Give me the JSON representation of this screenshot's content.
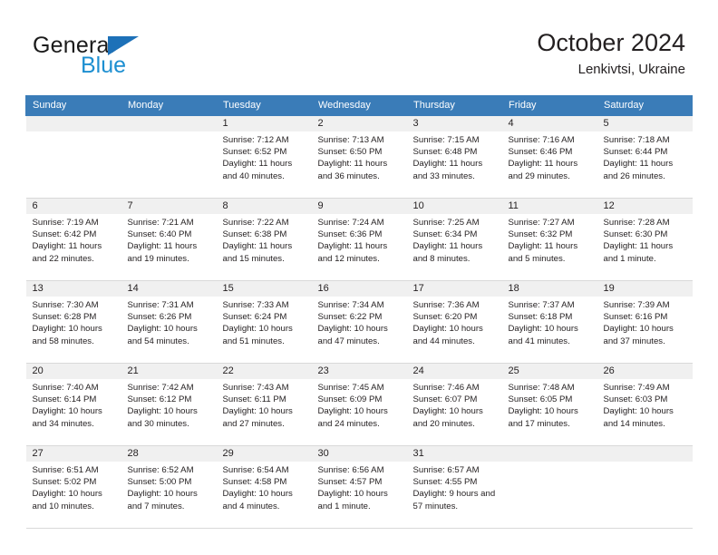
{
  "brand": {
    "name_top": "General",
    "name_bottom": "Blue",
    "triangle_color": "#1d71b8",
    "blue_color": "#1d8fd1"
  },
  "header": {
    "title": "October 2024",
    "subtitle": "Lenkivtsi, Ukraine"
  },
  "theme": {
    "header_row_bg": "#3a7cb8",
    "header_row_text": "#ffffff",
    "daynum_band_bg": "#f0f0f0",
    "grid_line": "#d9d9d9",
    "text": "#231f20"
  },
  "weekdays": [
    "Sunday",
    "Monday",
    "Tuesday",
    "Wednesday",
    "Thursday",
    "Friday",
    "Saturday"
  ],
  "labels": {
    "sunrise_prefix": "Sunrise:",
    "sunset_prefix": "Sunset:",
    "daylight_prefix": "Daylight:"
  },
  "weeks": [
    [
      {
        "day": "",
        "sunrise": "",
        "sunset": "",
        "daylight": ""
      },
      {
        "day": "",
        "sunrise": "",
        "sunset": "",
        "daylight": ""
      },
      {
        "day": "1",
        "sunrise": "Sunrise: 7:12 AM",
        "sunset": "Sunset: 6:52 PM",
        "daylight": "Daylight: 11 hours and 40 minutes."
      },
      {
        "day": "2",
        "sunrise": "Sunrise: 7:13 AM",
        "sunset": "Sunset: 6:50 PM",
        "daylight": "Daylight: 11 hours and 36 minutes."
      },
      {
        "day": "3",
        "sunrise": "Sunrise: 7:15 AM",
        "sunset": "Sunset: 6:48 PM",
        "daylight": "Daylight: 11 hours and 33 minutes."
      },
      {
        "day": "4",
        "sunrise": "Sunrise: 7:16 AM",
        "sunset": "Sunset: 6:46 PM",
        "daylight": "Daylight: 11 hours and 29 minutes."
      },
      {
        "day": "5",
        "sunrise": "Sunrise: 7:18 AM",
        "sunset": "Sunset: 6:44 PM",
        "daylight": "Daylight: 11 hours and 26 minutes."
      }
    ],
    [
      {
        "day": "6",
        "sunrise": "Sunrise: 7:19 AM",
        "sunset": "Sunset: 6:42 PM",
        "daylight": "Daylight: 11 hours and 22 minutes."
      },
      {
        "day": "7",
        "sunrise": "Sunrise: 7:21 AM",
        "sunset": "Sunset: 6:40 PM",
        "daylight": "Daylight: 11 hours and 19 minutes."
      },
      {
        "day": "8",
        "sunrise": "Sunrise: 7:22 AM",
        "sunset": "Sunset: 6:38 PM",
        "daylight": "Daylight: 11 hours and 15 minutes."
      },
      {
        "day": "9",
        "sunrise": "Sunrise: 7:24 AM",
        "sunset": "Sunset: 6:36 PM",
        "daylight": "Daylight: 11 hours and 12 minutes."
      },
      {
        "day": "10",
        "sunrise": "Sunrise: 7:25 AM",
        "sunset": "Sunset: 6:34 PM",
        "daylight": "Daylight: 11 hours and 8 minutes."
      },
      {
        "day": "11",
        "sunrise": "Sunrise: 7:27 AM",
        "sunset": "Sunset: 6:32 PM",
        "daylight": "Daylight: 11 hours and 5 minutes."
      },
      {
        "day": "12",
        "sunrise": "Sunrise: 7:28 AM",
        "sunset": "Sunset: 6:30 PM",
        "daylight": "Daylight: 11 hours and 1 minute."
      }
    ],
    [
      {
        "day": "13",
        "sunrise": "Sunrise: 7:30 AM",
        "sunset": "Sunset: 6:28 PM",
        "daylight": "Daylight: 10 hours and 58 minutes."
      },
      {
        "day": "14",
        "sunrise": "Sunrise: 7:31 AM",
        "sunset": "Sunset: 6:26 PM",
        "daylight": "Daylight: 10 hours and 54 minutes."
      },
      {
        "day": "15",
        "sunrise": "Sunrise: 7:33 AM",
        "sunset": "Sunset: 6:24 PM",
        "daylight": "Daylight: 10 hours and 51 minutes."
      },
      {
        "day": "16",
        "sunrise": "Sunrise: 7:34 AM",
        "sunset": "Sunset: 6:22 PM",
        "daylight": "Daylight: 10 hours and 47 minutes."
      },
      {
        "day": "17",
        "sunrise": "Sunrise: 7:36 AM",
        "sunset": "Sunset: 6:20 PM",
        "daylight": "Daylight: 10 hours and 44 minutes."
      },
      {
        "day": "18",
        "sunrise": "Sunrise: 7:37 AM",
        "sunset": "Sunset: 6:18 PM",
        "daylight": "Daylight: 10 hours and 41 minutes."
      },
      {
        "day": "19",
        "sunrise": "Sunrise: 7:39 AM",
        "sunset": "Sunset: 6:16 PM",
        "daylight": "Daylight: 10 hours and 37 minutes."
      }
    ],
    [
      {
        "day": "20",
        "sunrise": "Sunrise: 7:40 AM",
        "sunset": "Sunset: 6:14 PM",
        "daylight": "Daylight: 10 hours and 34 minutes."
      },
      {
        "day": "21",
        "sunrise": "Sunrise: 7:42 AM",
        "sunset": "Sunset: 6:12 PM",
        "daylight": "Daylight: 10 hours and 30 minutes."
      },
      {
        "day": "22",
        "sunrise": "Sunrise: 7:43 AM",
        "sunset": "Sunset: 6:11 PM",
        "daylight": "Daylight: 10 hours and 27 minutes."
      },
      {
        "day": "23",
        "sunrise": "Sunrise: 7:45 AM",
        "sunset": "Sunset: 6:09 PM",
        "daylight": "Daylight: 10 hours and 24 minutes."
      },
      {
        "day": "24",
        "sunrise": "Sunrise: 7:46 AM",
        "sunset": "Sunset: 6:07 PM",
        "daylight": "Daylight: 10 hours and 20 minutes."
      },
      {
        "day": "25",
        "sunrise": "Sunrise: 7:48 AM",
        "sunset": "Sunset: 6:05 PM",
        "daylight": "Daylight: 10 hours and 17 minutes."
      },
      {
        "day": "26",
        "sunrise": "Sunrise: 7:49 AM",
        "sunset": "Sunset: 6:03 PM",
        "daylight": "Daylight: 10 hours and 14 minutes."
      }
    ],
    [
      {
        "day": "27",
        "sunrise": "Sunrise: 6:51 AM",
        "sunset": "Sunset: 5:02 PM",
        "daylight": "Daylight: 10 hours and 10 minutes."
      },
      {
        "day": "28",
        "sunrise": "Sunrise: 6:52 AM",
        "sunset": "Sunset: 5:00 PM",
        "daylight": "Daylight: 10 hours and 7 minutes."
      },
      {
        "day": "29",
        "sunrise": "Sunrise: 6:54 AM",
        "sunset": "Sunset: 4:58 PM",
        "daylight": "Daylight: 10 hours and 4 minutes."
      },
      {
        "day": "30",
        "sunrise": "Sunrise: 6:56 AM",
        "sunset": "Sunset: 4:57 PM",
        "daylight": "Daylight: 10 hours and 1 minute."
      },
      {
        "day": "31",
        "sunrise": "Sunrise: 6:57 AM",
        "sunset": "Sunset: 4:55 PM",
        "daylight": "Daylight: 9 hours and 57 minutes."
      },
      {
        "day": "",
        "sunrise": "",
        "sunset": "",
        "daylight": ""
      },
      {
        "day": "",
        "sunrise": "",
        "sunset": "",
        "daylight": ""
      }
    ]
  ]
}
